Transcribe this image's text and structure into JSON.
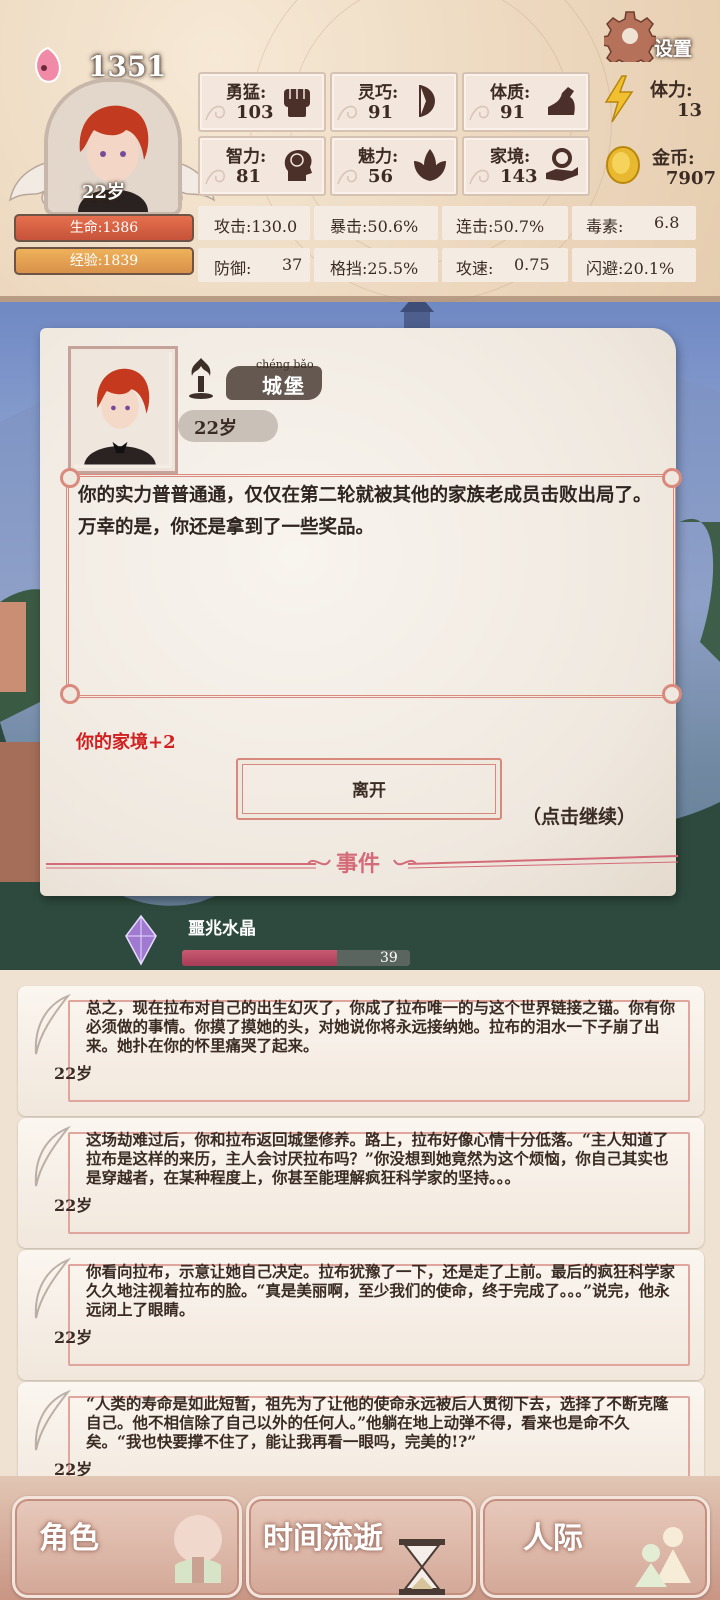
{
  "header": {
    "coins_top": "1351",
    "age_badge": "22岁",
    "hp_label": "生命:1386",
    "exp_label": "经验:1839",
    "settings_label": "设置",
    "stats": [
      {
        "label": "勇猛:",
        "value": "103",
        "icon": "fist-icon"
      },
      {
        "label": "灵巧:",
        "value": "91",
        "icon": "bow-icon"
      },
      {
        "label": "体质:",
        "value": "91",
        "icon": "arm-icon"
      },
      {
        "label": "智力:",
        "value": "81",
        "icon": "brain-head-icon"
      },
      {
        "label": "魅力:",
        "value": "56",
        "icon": "lotus-icon"
      },
      {
        "label": "家境:",
        "value": "143",
        "icon": "hand-coin-icon"
      }
    ],
    "stamina": {
      "label": "体力:",
      "value": "13",
      "icon": "lightning-icon"
    },
    "gold": {
      "label": "金币:",
      "value": "7907",
      "icon": "gold-coin-icon"
    },
    "attrs": [
      {
        "label": "攻击:130.0"
      },
      {
        "label": "暴击:50.6%"
      },
      {
        "label": "连击:50.7%"
      },
      {
        "label": "毒素:",
        "value": "6.8"
      },
      {
        "label": "防御:",
        "value": "37"
      },
      {
        "label": "格挡:25.5%"
      },
      {
        "label": "攻速:",
        "value": "0.75"
      },
      {
        "label": "闪避:20.1%"
      }
    ]
  },
  "event": {
    "location_pinyin": "chéng bǎo",
    "location_name": "城堡",
    "age": "22岁",
    "text": "你的实力普普通通，仅仅在第二轮就被其他的家族老成员击败出局了。万幸的是，你还是拿到了一些奖品。",
    "reward": "你的家境+2",
    "leave_label": "离开",
    "continue_hint": "（点击继续）",
    "section_label": "事件"
  },
  "crystal": {
    "name": "噩兆水晶",
    "value": "39",
    "progress": 0.68
  },
  "log": [
    {
      "age": "22岁",
      "text": "总之，现在拉布对自己的出生幻灭了，你成了拉布唯一的与这个世界链接之锚。你有你必须做的事情。你摸了摸她的头，对她说你将永远接纳她。拉布的泪水一下子崩了出来。她扑在你的怀里痛哭了起来。"
    },
    {
      "age": "22岁",
      "text": "这场劫难过后，你和拉布返回城堡修养。路上，拉布好像心情十分低落。“主人知道了拉布是这样的来历，主人会讨厌拉布吗？”你没想到她竟然为这个烦恼，你自己其实也是穿越者，在某种程度上，你甚至能理解疯狂科学家的坚持。。。"
    },
    {
      "age": "22岁",
      "text": "你看向拉布，示意让她自己决定。拉布犹豫了一下，还是走了上前。最后的疯狂科学家久久地注视着拉布的脸。“真是美丽啊，至少我们的使命，终于完成了。。。”说完，他永远闭上了眼睛。"
    },
    {
      "age": "22岁",
      "text": "“人类的寿命是如此短暂，祖先为了让他的使命永远被后人贯彻下去，选择了不断克隆自己。他不相信除了自己以外的任何人。”他躺在地上动弹不得，看来也是命不久矣。“我也快要撑不住了，能让我再看一眼吗，完美的!?”"
    }
  ],
  "nav": {
    "role_label": "角色",
    "time_label": "时间流逝",
    "social_label": "人际"
  }
}
